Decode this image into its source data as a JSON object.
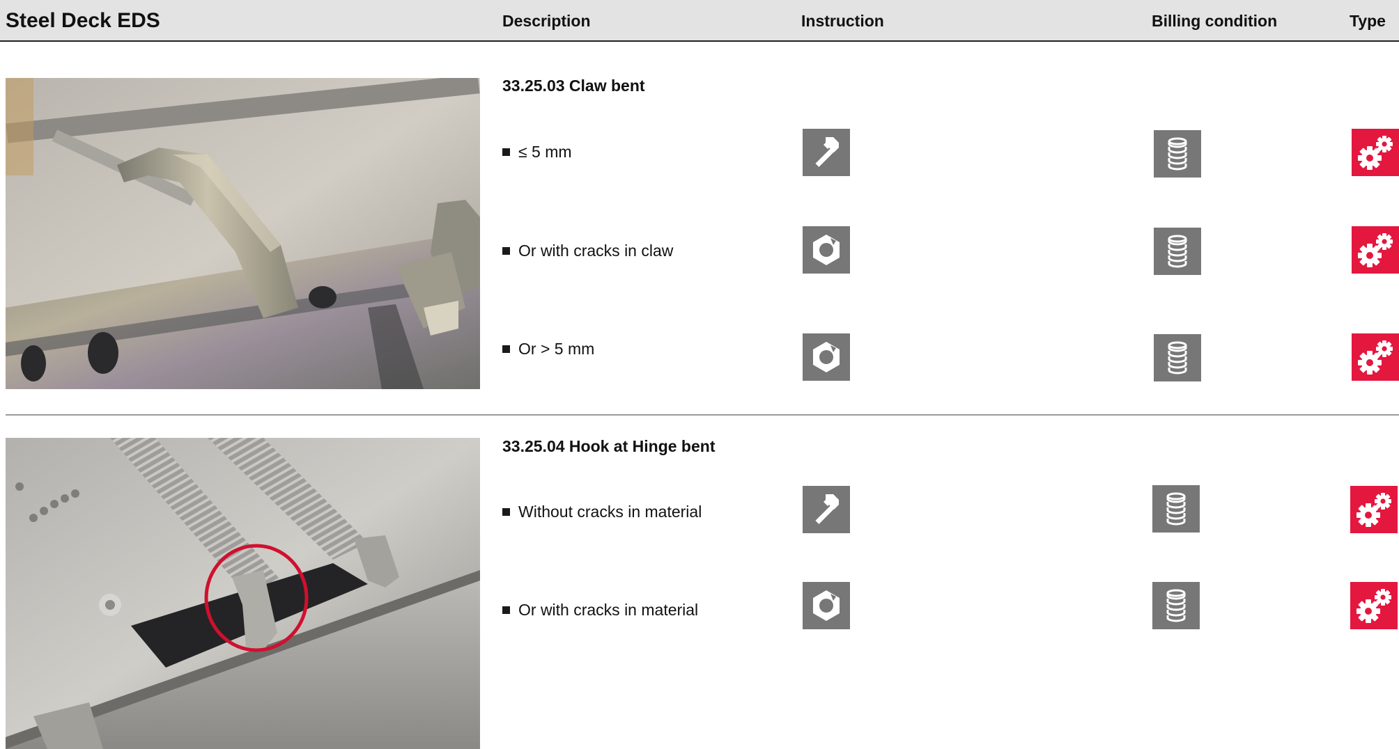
{
  "header": {
    "title": "Steel Deck EDS",
    "col_description": "Description",
    "col_instruction": "Instruction",
    "col_billing": "Billing condition",
    "col_type": "Type"
  },
  "sections": [
    {
      "title": "33.25.03 Claw bent",
      "rows": [
        {
          "label": "≤ 5 mm",
          "instruction_icon": "hammer-icon",
          "billing_icon": "coin-stack-icon",
          "type_icon": "gears-icon"
        },
        {
          "label": "Or with cracks in claw",
          "instruction_icon": "hex-nut-icon",
          "billing_icon": "coin-stack-icon",
          "type_icon": "gears-icon"
        },
        {
          "label": "Or > 5 mm",
          "instruction_icon": "hex-nut-icon",
          "billing_icon": "coin-stack-icon",
          "type_icon": "gears-icon"
        }
      ]
    },
    {
      "title": "33.25.04 Hook at Hinge bent",
      "rows": [
        {
          "label": "Without cracks in material",
          "instruction_icon": "hammer-icon",
          "billing_icon": "coin-stack-icon",
          "type_icon": "gears-icon"
        },
        {
          "label": "Or with cracks in material",
          "instruction_icon": "hex-nut-icon",
          "billing_icon": "coin-stack-icon",
          "type_icon": "gears-icon"
        }
      ]
    }
  ],
  "colors": {
    "header_bg": "#e3e3e3",
    "icon_gray": "#777777",
    "icon_red": "#e4173f",
    "highlight_circle": "#d0102f"
  }
}
